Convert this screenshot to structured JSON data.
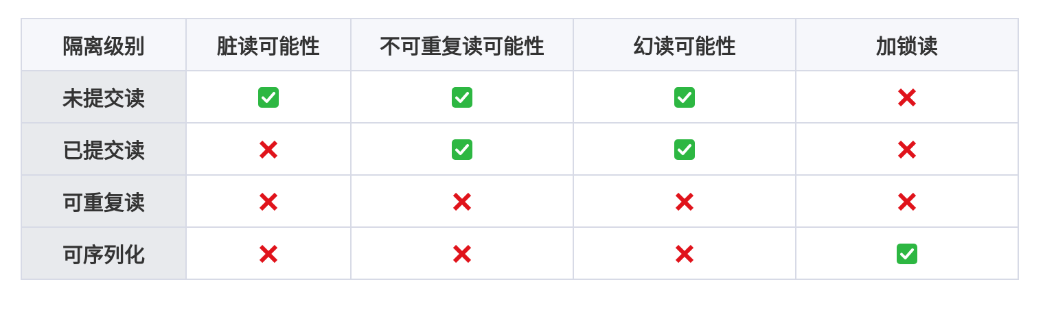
{
  "table": {
    "headers": [
      "隔离级别",
      "脏读可能性",
      "不可重复读可能性",
      "幻读可能性",
      "加锁读"
    ],
    "rows": [
      {
        "level": "未提交读",
        "cells": [
          "✅",
          "✅",
          "✅",
          "❌"
        ]
      },
      {
        "level": "已提交读",
        "cells": [
          "❌",
          "✅",
          "✅",
          "❌"
        ]
      },
      {
        "level": "可重复读",
        "cells": [
          "❌",
          "❌",
          "❌",
          "❌"
        ]
      },
      {
        "level": "可序列化",
        "cells": [
          "❌",
          "❌",
          "❌",
          "✅"
        ]
      }
    ]
  },
  "icons": {
    "✅": "check-mark-button-icon",
    "❌": "cross-mark-icon"
  },
  "colors": {
    "check_bg": "#2db742",
    "cross": "#e0131b",
    "header_bg": "#f6f7fb",
    "row_header_bg": "#e8eaed",
    "border": "#d7dae6"
  }
}
